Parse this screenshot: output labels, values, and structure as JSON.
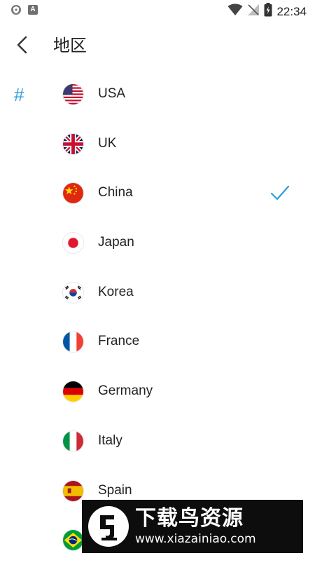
{
  "status_bar": {
    "time": "22:34",
    "left_icons": [
      "shield-icon",
      "a-icon"
    ],
    "letter_icon_text": "A",
    "right_icons": [
      "wifi-icon",
      "no-signal-icon",
      "battery-icon"
    ]
  },
  "header": {
    "title": "地区",
    "back_icon": "chevron-left-icon"
  },
  "index": {
    "letter": "#",
    "color": "#29a0dc"
  },
  "countries": [
    {
      "name": "USA",
      "flag": "usa-flag-icon",
      "selected": false
    },
    {
      "name": "UK",
      "flag": "uk-flag-icon",
      "selected": false
    },
    {
      "name": "China",
      "flag": "china-flag-icon",
      "selected": true
    },
    {
      "name": "Japan",
      "flag": "japan-flag-icon",
      "selected": false
    },
    {
      "name": "Korea",
      "flag": "korea-flag-icon",
      "selected": false
    },
    {
      "name": "France",
      "flag": "france-flag-icon",
      "selected": false
    },
    {
      "name": "Germany",
      "flag": "germany-flag-icon",
      "selected": false
    },
    {
      "name": "Italy",
      "flag": "italy-flag-icon",
      "selected": false
    },
    {
      "name": "Spain",
      "flag": "spain-flag-icon",
      "selected": false
    },
    {
      "name": "",
      "flag": "brazil-flag-icon",
      "selected": false
    }
  ],
  "colors": {
    "accent": "#29a0dc",
    "text": "#222222",
    "check": "#29a0dc"
  },
  "watermark": {
    "title": "下载鸟资源",
    "url": "www.xiazainiao.com"
  }
}
